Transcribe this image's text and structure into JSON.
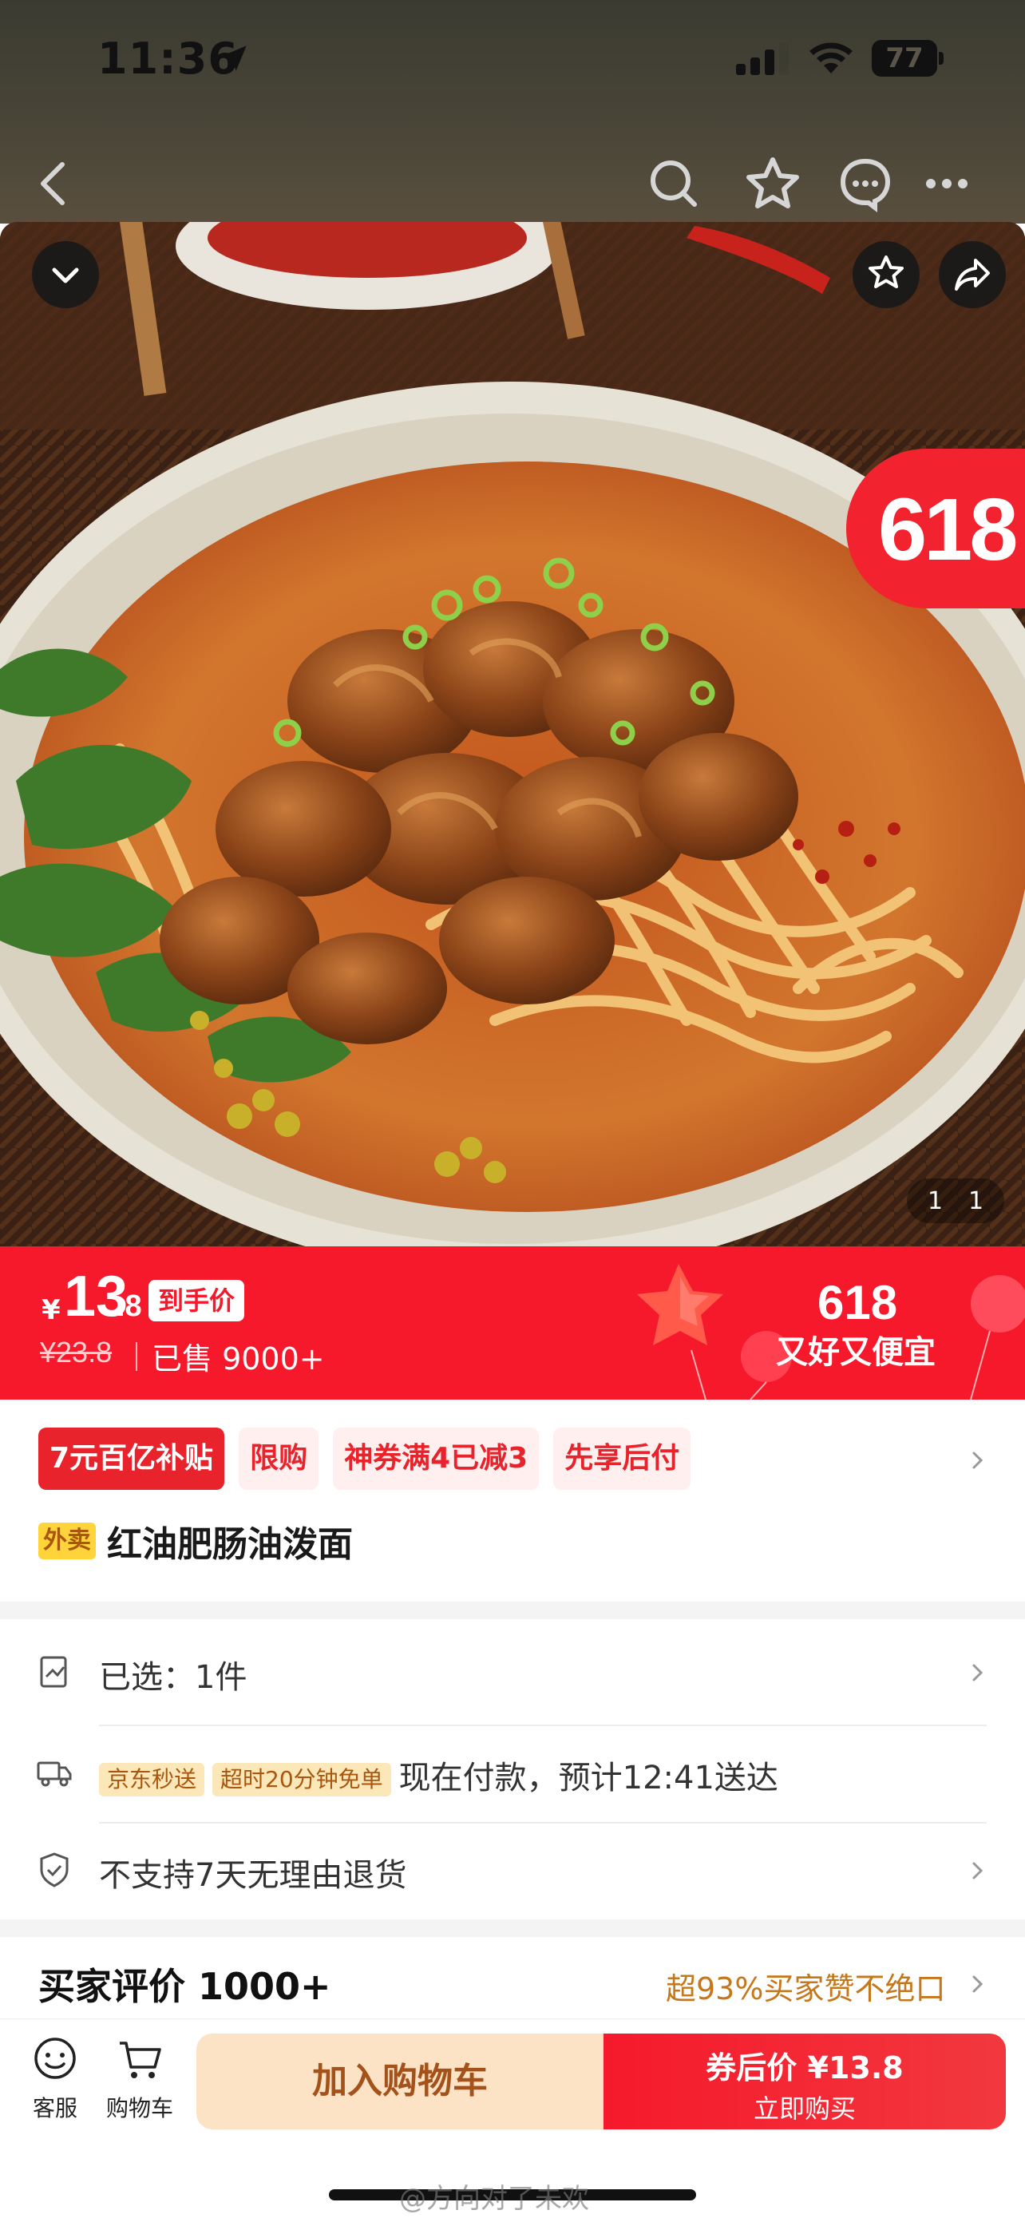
{
  "status_bar": {
    "time": "11:36",
    "battery": "77",
    "battery_level": 0.77,
    "icons": [
      "location-arrow-icon",
      "cellular-signal-icon",
      "wifi-icon",
      "battery-icon"
    ]
  },
  "nav": {
    "icons": [
      "back-icon",
      "search-icon",
      "star-icon",
      "customer-service-icon",
      "more-icon"
    ]
  },
  "gallery": {
    "badge": "618",
    "pager_current": "1",
    "pager_total": "1",
    "icons": [
      "collapse-icon",
      "favorite-icon",
      "share-icon"
    ]
  },
  "price_banner": {
    "currency": "¥",
    "price_int": "13",
    "price_dec": ".8",
    "handprice_label": "到手价",
    "original_price": "¥23.8",
    "sold": "已售 9000+",
    "promo_618": "618",
    "promo_slogan": "又好又便宜",
    "colors": {
      "background": "#f5192b"
    }
  },
  "tags": [
    "7元百亿补贴",
    "限购",
    "神券满4已减3",
    "先享后付"
  ],
  "product": {
    "badge": "外卖",
    "title": "红油肥肠油泼面"
  },
  "selection": {
    "label": "已选：1件"
  },
  "delivery": {
    "badge1": "京东秒送",
    "badge2": "超时20分钟免单",
    "text": "现在付款，预计12:41送达"
  },
  "returns": {
    "text": "不支持7天无理由退货"
  },
  "reviews": {
    "title": "买家评价 1000+",
    "praise": "超93%买家赞不绝口"
  },
  "bottom_bar": {
    "service_label": "客服",
    "cart_label": "购物车",
    "add_to_cart": "加入购物车",
    "buy_line1": "券后价 ¥13.8",
    "buy_line2": "立即购买"
  },
  "watermark": "@方向对了未欢"
}
